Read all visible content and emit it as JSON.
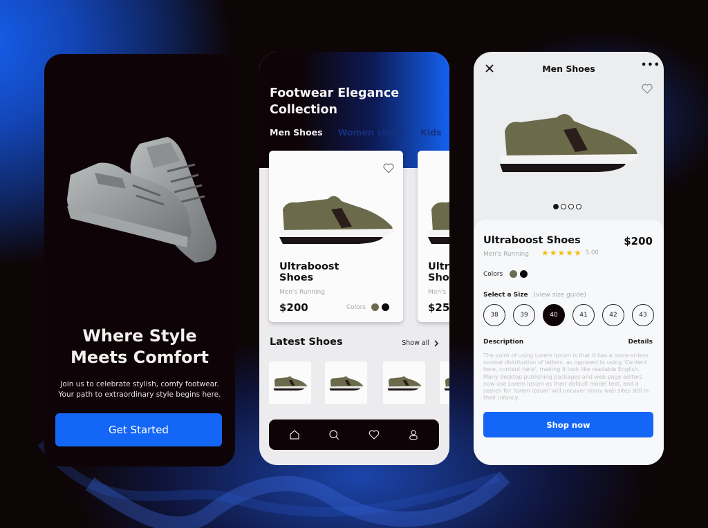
{
  "colors": {
    "accent": "#1466f6",
    "dark": "#0e0407",
    "olive": "#6b6a52",
    "black_swatch": "#0c0a0a",
    "star": "#f3be1c"
  },
  "onboarding": {
    "image": "sneaker-pair-image",
    "title_line1": "Where Style",
    "title_line2": "Meets Comfort",
    "subtitle_line1": "Join us to celebrate stylish, comfy footwear.",
    "subtitle_line2": "Your path to extraordinary style begins here.",
    "cta_label": "Get Started"
  },
  "catalog": {
    "title_line1": "Footwear Elegance",
    "title_line2": "Collection",
    "tabs": [
      {
        "label": "Men Shoes",
        "active": true
      },
      {
        "label": "Women shoes",
        "active": false
      },
      {
        "label": "Kids",
        "active": false
      }
    ],
    "cards": [
      {
        "name_line1": "Ultraboost",
        "name_line2": "Shoes",
        "category": "Men's Running",
        "price": "$200",
        "colors_label": "Colors",
        "favorite_icon": "heart-icon"
      },
      {
        "name_line1": "Ultra",
        "name_line2": "Sho",
        "category": "Men's",
        "price": "$25"
      }
    ],
    "latest": {
      "title": "Latest Shoes",
      "show_all": "Show all",
      "thumb_count": 4
    },
    "nav": [
      {
        "name": "home-icon"
      },
      {
        "name": "search-icon"
      },
      {
        "name": "heart-icon"
      },
      {
        "name": "user-icon"
      }
    ]
  },
  "detail": {
    "header_title": "Men Shoes",
    "close_icon": "close-icon",
    "more_label": "•••",
    "carousel": {
      "count": 4,
      "active_index": 0
    },
    "product": {
      "name": "Ultraboost Shoes",
      "price": "$200",
      "category": "Men's Running",
      "rating_value": 5.0,
      "rating_text": "5.00",
      "stars": [
        "★",
        "★",
        "★",
        "★",
        "★"
      ],
      "colors_label": "Colors"
    },
    "size": {
      "label": "Select a Size",
      "guide": "(view size guide)",
      "options": [
        "38",
        "39",
        "40",
        "41",
        "42",
        "43"
      ],
      "selected": "40"
    },
    "description_label": "Description",
    "details_label": "Details",
    "description_text": "The point of using Lorem Ipsum is that it has a more-or-less normal distribution of letters, as opposed to using 'Content here, content here', making it look like readable English. Many desktop publishing packages and web page editors now use Lorem Ipsum as their default model text, and a search for 'lorem ipsum' will uncover many web sites still in their infancy.",
    "cta_label": "Shop now"
  }
}
